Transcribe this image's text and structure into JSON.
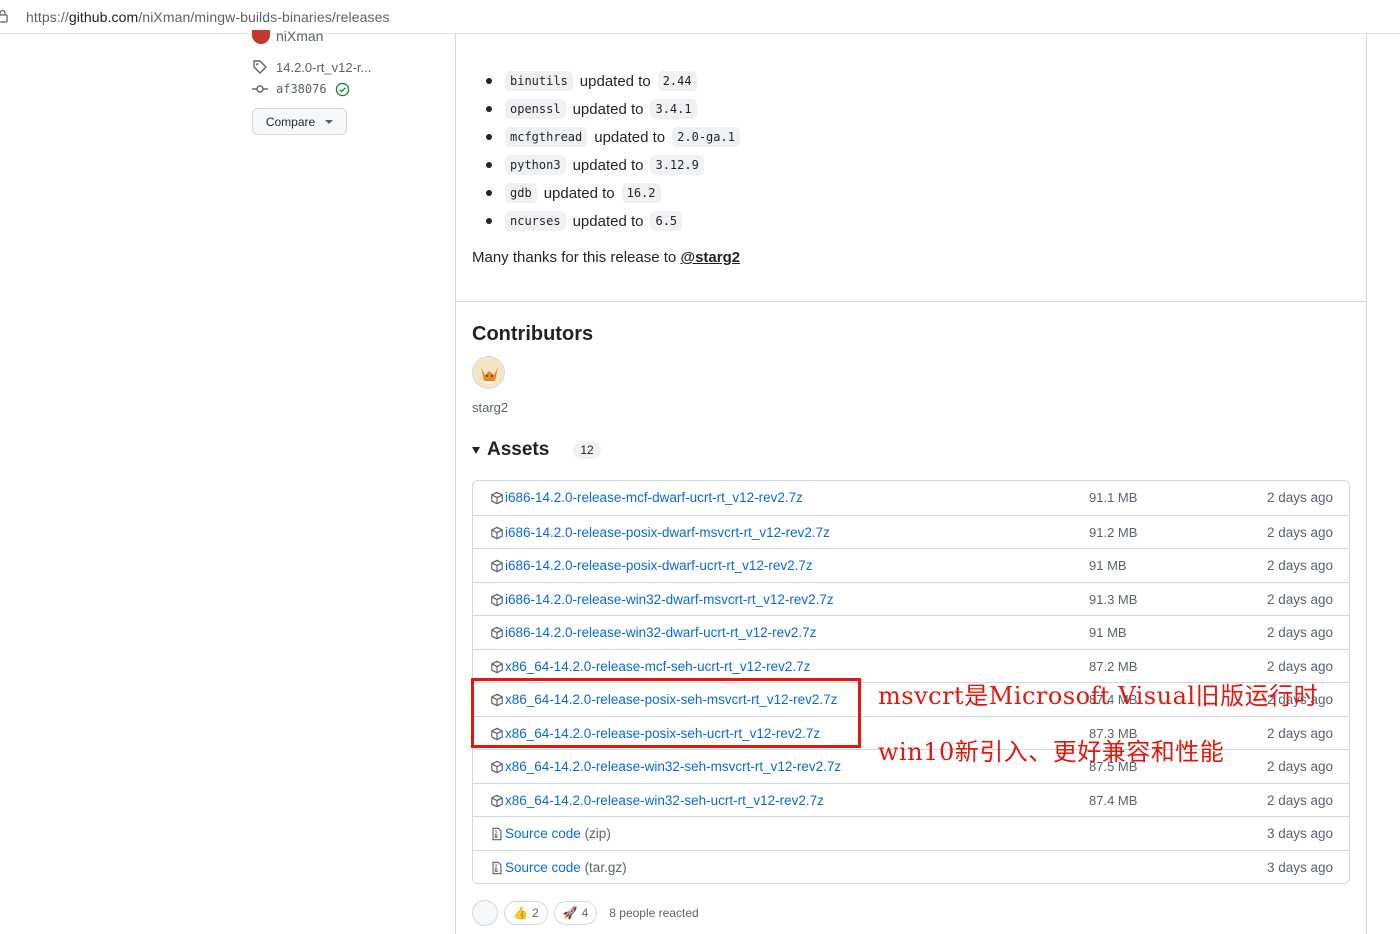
{
  "browser": {
    "url_prefix": "https://",
    "url_domain": "github.com",
    "url_path": "/niXman/mingw-builds-binaries/releases"
  },
  "sidebar": {
    "author": "niXman",
    "tag": "14.2.0-rt_v12-r...",
    "commit": "af38076",
    "compare_label": "Compare"
  },
  "updates": [
    {
      "pkg": "binutils",
      "word": "updated to",
      "ver": "2.44"
    },
    {
      "pkg": "openssl",
      "word": "updated to",
      "ver": "3.4.1"
    },
    {
      "pkg": "mcfgthread",
      "word": "updated to",
      "ver": "2.0-ga.1"
    },
    {
      "pkg": "python3",
      "word": "updated to",
      "ver": "3.12.9"
    },
    {
      "pkg": "gdb",
      "word": "updated to",
      "ver": "16.2"
    },
    {
      "pkg": "ncurses",
      "word": "updated to",
      "ver": "6.5"
    }
  ],
  "thanks": {
    "text": "Many thanks for this release to ",
    "mention": "@starg2"
  },
  "contributors": {
    "title": "Contributors",
    "name": "starg2"
  },
  "assets": {
    "title": "Assets",
    "count": "12",
    "items": [
      {
        "name": "i686-14.2.0-release-mcf-dwarf-ucrt-rt_v12-rev2.7z",
        "ext": "",
        "size": "91.1 MB",
        "date": "2 days ago",
        "icon": "package-icon"
      },
      {
        "name": "i686-14.2.0-release-posix-dwarf-msvcrt-rt_v12-rev2.7z",
        "ext": "",
        "size": "91.2 MB",
        "date": "2 days ago",
        "icon": "package-icon"
      },
      {
        "name": "i686-14.2.0-release-posix-dwarf-ucrt-rt_v12-rev2.7z",
        "ext": "",
        "size": "91 MB",
        "date": "2 days ago",
        "icon": "package-icon"
      },
      {
        "name": "i686-14.2.0-release-win32-dwarf-msvcrt-rt_v12-rev2.7z",
        "ext": "",
        "size": "91.3 MB",
        "date": "2 days ago",
        "icon": "package-icon"
      },
      {
        "name": "i686-14.2.0-release-win32-dwarf-ucrt-rt_v12-rev2.7z",
        "ext": "",
        "size": "91 MB",
        "date": "2 days ago",
        "icon": "package-icon"
      },
      {
        "name": "x86_64-14.2.0-release-mcf-seh-ucrt-rt_v12-rev2.7z",
        "ext": "",
        "size": "87.2 MB",
        "date": "2 days ago",
        "icon": "package-icon"
      },
      {
        "name": "x86_64-14.2.0-release-posix-seh-msvcrt-rt_v12-rev2.7z",
        "ext": "",
        "size": "87.4 MB",
        "date": "2 days ago",
        "icon": "package-icon"
      },
      {
        "name": "x86_64-14.2.0-release-posix-seh-ucrt-rt_v12-rev2.7z",
        "ext": "",
        "size": "87.3 MB",
        "date": "2 days ago",
        "icon": "package-icon"
      },
      {
        "name": "x86_64-14.2.0-release-win32-seh-msvcrt-rt_v12-rev2.7z",
        "ext": "",
        "size": "87.5 MB",
        "date": "2 days ago",
        "icon": "package-icon"
      },
      {
        "name": "x86_64-14.2.0-release-win32-seh-ucrt-rt_v12-rev2.7z",
        "ext": "",
        "size": "87.4 MB",
        "date": "2 days ago",
        "icon": "package-icon"
      },
      {
        "name": "Source code",
        "ext": " (zip)",
        "size": "",
        "date": "3 days ago",
        "icon": "file-zip-icon"
      },
      {
        "name": "Source code",
        "ext": " (tar.gz)",
        "size": "",
        "date": "3 days ago",
        "icon": "file-zip-icon"
      }
    ]
  },
  "annotations": {
    "line1": "msvcrt是Microsoft Visual旧版运行时",
    "line2": "win10新引入、更好兼容和性能",
    "color": "#e3180d"
  },
  "reactions": {
    "thumbs_up": "2",
    "rocket": "4",
    "summary": "8 people reacted"
  }
}
